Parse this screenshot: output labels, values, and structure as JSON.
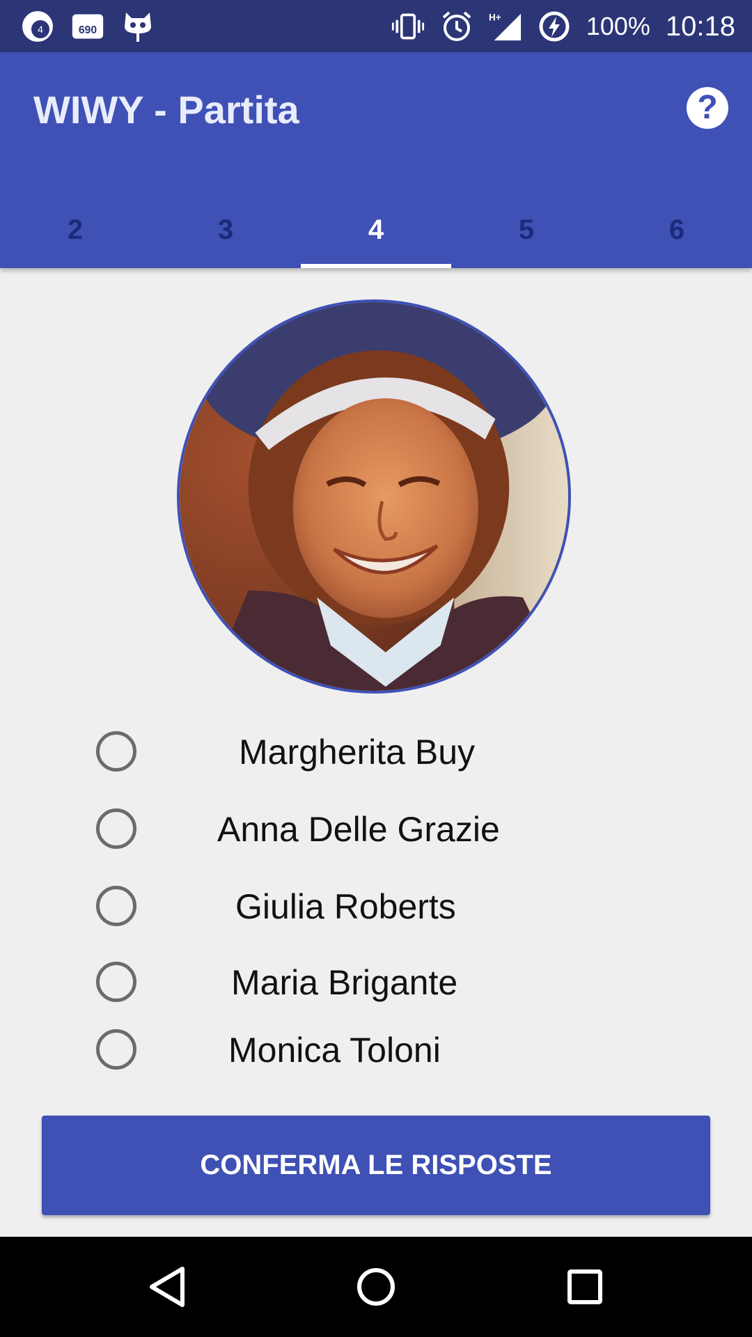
{
  "status_bar": {
    "notif_badge_1": "4",
    "notif_badge_2": "690",
    "battery_percent": "100%",
    "time": "10:18",
    "network_label": "H+"
  },
  "app_bar": {
    "title": "WIWY - Partita",
    "help_icon": "help-circle-icon"
  },
  "tabs": [
    {
      "label": "2",
      "active": false
    },
    {
      "label": "3",
      "active": false
    },
    {
      "label": "4",
      "active": true
    },
    {
      "label": "5",
      "active": false
    },
    {
      "label": "6",
      "active": false
    }
  ],
  "options": [
    {
      "label": "Margherita Buy",
      "selected": false
    },
    {
      "label": "Anna Delle Grazie",
      "selected": false
    },
    {
      "label": "Giulia Roberts",
      "selected": false
    },
    {
      "label": "Maria Brigante",
      "selected": false
    },
    {
      "label": "Monica Toloni",
      "selected": false
    }
  ],
  "confirm_button": {
    "label": "CONFERMA LE RISPOSTE"
  },
  "colors": {
    "primary": "#3f51b5",
    "status_bar": "#2c3576",
    "background": "#efeff0"
  }
}
